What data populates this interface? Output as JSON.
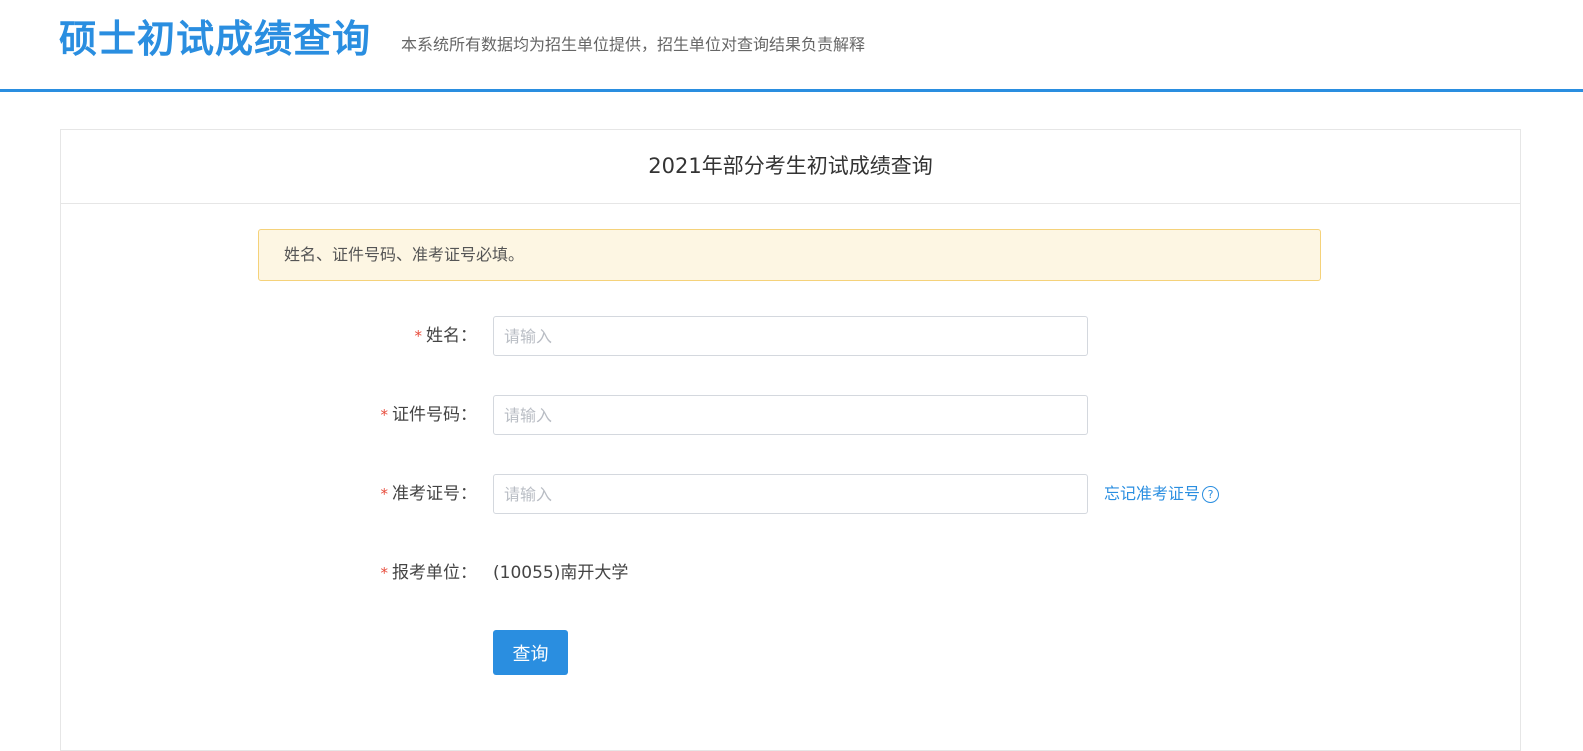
{
  "header": {
    "title": "硕士初试成绩查询",
    "subtitle": "本系统所有数据均为招生单位提供，招生单位对查询结果负责解释"
  },
  "panel": {
    "title": "2021年部分考生初试成绩查询",
    "notice": "姓名、证件号码、准考证号必填。"
  },
  "form": {
    "required_mark": "*",
    "name": {
      "label": "姓名：",
      "placeholder": "请输入",
      "value": ""
    },
    "id_number": {
      "label": "证件号码：",
      "placeholder": "请输入",
      "value": ""
    },
    "exam_number": {
      "label": "准考证号：",
      "placeholder": "请输入",
      "value": ""
    },
    "forgot_exam_number": {
      "label": "忘记准考证号",
      "icon": "question-circle-icon",
      "icon_glyph": "?"
    },
    "institution": {
      "label": "报考单位：",
      "value": "(10055)南开大学"
    },
    "submit_label": "查询"
  },
  "colors": {
    "accent": "#2a8ee0",
    "required": "#e74c3c",
    "notice_bg": "#fdf6e3",
    "notice_border": "#f5d27a"
  }
}
